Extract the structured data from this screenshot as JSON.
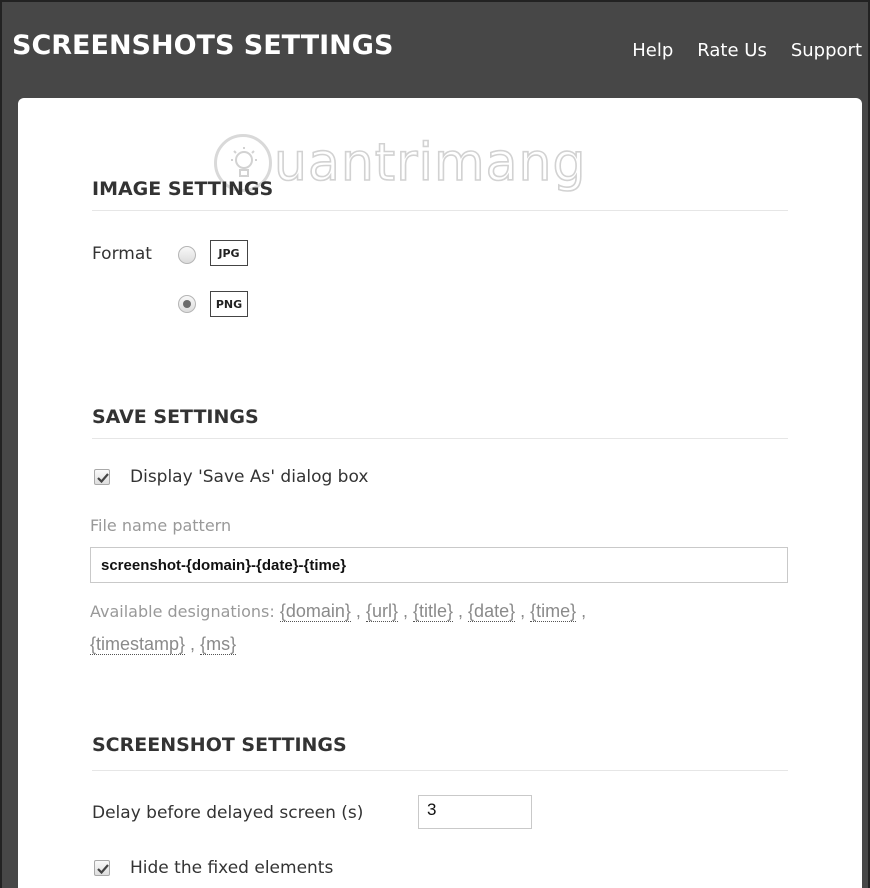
{
  "header": {
    "title": "SCREENSHOTS SETTINGS",
    "nav": [
      "Help",
      "Rate Us",
      "Support"
    ]
  },
  "watermark": {
    "text": "uantrimang"
  },
  "image_settings": {
    "title": "IMAGE SETTINGS",
    "format_label": "Format",
    "options": [
      {
        "label": "JPG",
        "checked": false
      },
      {
        "label": "PNG",
        "checked": true
      }
    ]
  },
  "save_settings": {
    "title": "SAVE SETTINGS",
    "save_as_label": "Display 'Save As' dialog box",
    "save_as_checked": true,
    "file_name_label": "File name pattern",
    "file_name_value": "screenshot-{domain}-{date}-{time}",
    "designations_label": "Available designations:",
    "designations": [
      "{domain}",
      "{url}",
      "{title}",
      "{date}",
      "{time}",
      "{timestamp}",
      "{ms}"
    ]
  },
  "screenshot_settings": {
    "title": "SCREENSHOT SETTINGS",
    "delay_label": "Delay before delayed screen (s)",
    "delay_value": "3",
    "hide_fixed_label": "Hide the fixed elements",
    "hide_fixed_checked": true
  }
}
